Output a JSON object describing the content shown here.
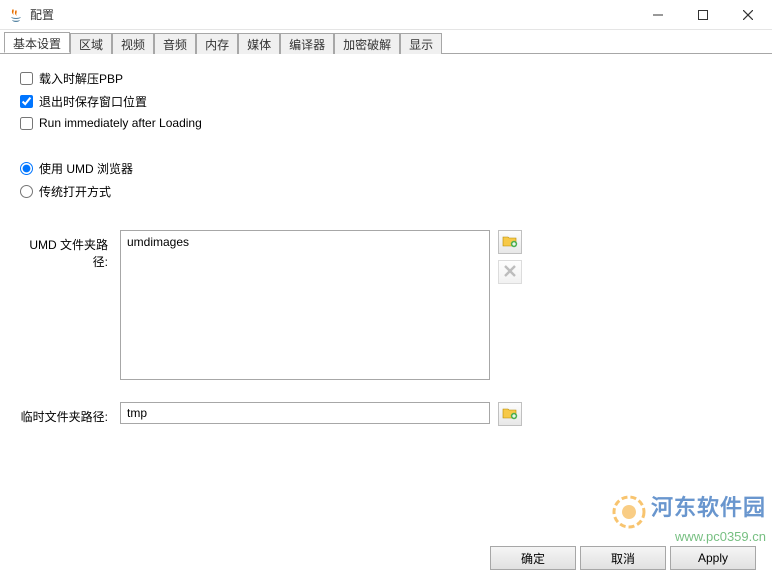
{
  "window": {
    "title": "配置"
  },
  "tabs": [
    {
      "label": "基本设置",
      "active": true
    },
    {
      "label": "区域",
      "active": false
    },
    {
      "label": "视频",
      "active": false
    },
    {
      "label": "音频",
      "active": false
    },
    {
      "label": "内存",
      "active": false
    },
    {
      "label": "媒体",
      "active": false
    },
    {
      "label": "编译器",
      "active": false
    },
    {
      "label": "加密破解",
      "active": false
    },
    {
      "label": "显示",
      "active": false
    }
  ],
  "checkboxes": {
    "unpack_pbp": {
      "label": "载入时解压PBP",
      "checked": false
    },
    "save_window_pos": {
      "label": "退出时保存窗口位置",
      "checked": true
    },
    "run_immediately": {
      "label": "Run immediately after Loading",
      "checked": false
    }
  },
  "radios": {
    "umd_browser": {
      "label": "使用 UMD 浏览器",
      "selected": true
    },
    "classic_open": {
      "label": "传统打开方式",
      "selected": false
    }
  },
  "fields": {
    "umd_path": {
      "label": "UMD 文件夹路径:",
      "value": "umdimages"
    },
    "tmp_path": {
      "label": "临时文件夹路径:",
      "value": "tmp"
    }
  },
  "buttons": {
    "ok": "确定",
    "cancel": "取消",
    "apply": "Apply"
  },
  "watermark": {
    "name": "河东软件园",
    "url": "www.pc0359.cn"
  }
}
